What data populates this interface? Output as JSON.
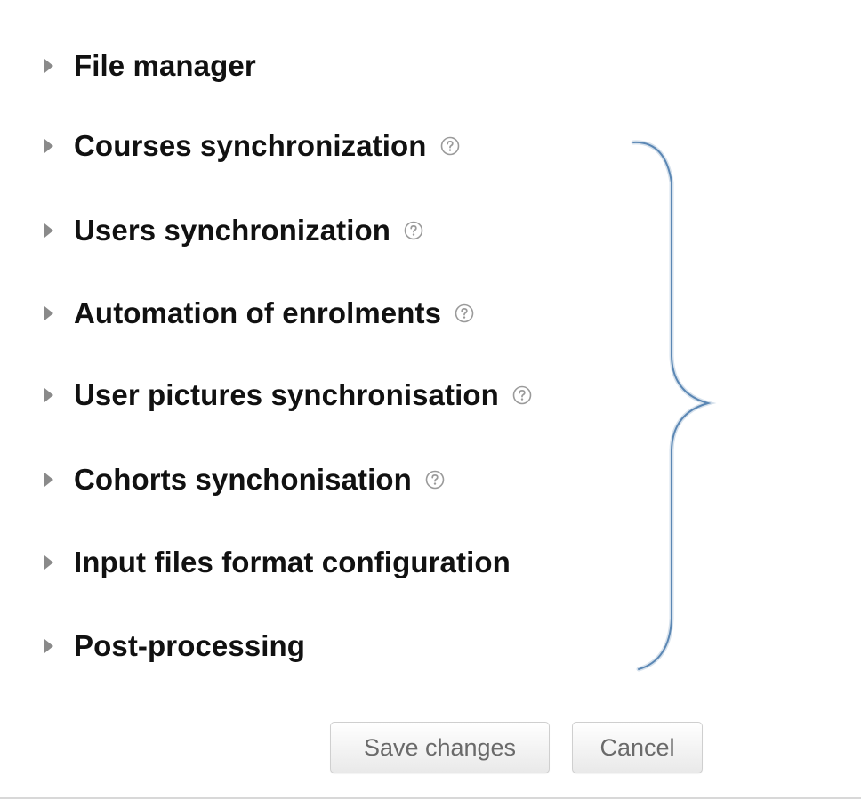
{
  "sections": [
    {
      "label": "File manager",
      "has_help": false
    },
    {
      "label": "Courses synchronization",
      "has_help": true
    },
    {
      "label": "Users synchronization",
      "has_help": true
    },
    {
      "label": "Automation of enrolments",
      "has_help": true
    },
    {
      "label": "User pictures synchronisation",
      "has_help": true
    },
    {
      "label": "Cohorts synchonisation",
      "has_help": true
    },
    {
      "label": "Input files format configuration",
      "has_help": false
    },
    {
      "label": "Post-processing",
      "has_help": false
    }
  ],
  "buttons": {
    "save_label": "Save changes",
    "cancel_label": "Cancel"
  },
  "icons": {
    "section_toggle": "caret-right-icon",
    "help": "help-icon",
    "annotation": "curly-brace-annotation"
  },
  "colors": {
    "caret": "#8a8a8a",
    "help_icon": "#9a9a9a",
    "brace": "#5b87b4",
    "button_text": "#6a6a6a"
  }
}
